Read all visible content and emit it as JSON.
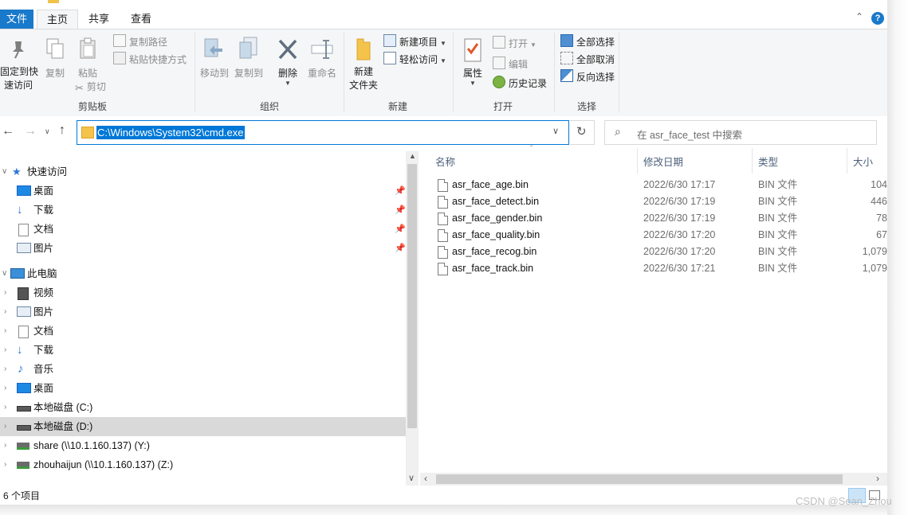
{
  "tabs": {
    "file": "文件",
    "home": "主页",
    "share": "共享",
    "view": "查看"
  },
  "ribbon": {
    "clipboard": {
      "pin_label": "固定到快\n速访问",
      "copy_label": "复制",
      "paste_label": "粘贴",
      "copy_path": "复制路径",
      "paste_shortcut": "粘贴快捷方式",
      "cut": "剪切",
      "group": "剪贴板"
    },
    "organize": {
      "move_to": "移动到",
      "copy_to": "复制到",
      "delete": "删除",
      "rename": "重命名",
      "group": "组织"
    },
    "new": {
      "new_folder": "新建\n文件夹",
      "new_item": "新建项目",
      "easy_access": "轻松访问",
      "group": "新建"
    },
    "open": {
      "properties": "属性",
      "open": "打开",
      "edit": "编辑",
      "history": "历史记录",
      "group": "打开"
    },
    "select": {
      "select_all": "全部选择",
      "select_none": "全部取消",
      "invert": "反向选择",
      "group": "选择"
    }
  },
  "address": {
    "path": "C:\\Windows\\System32\\cmd.exe"
  },
  "search": {
    "placeholder": "在 asr_face_test 中搜索"
  },
  "navpane": {
    "quick_access": "快速访问",
    "quick_items": [
      "桌面",
      "下载",
      "文档",
      "图片"
    ],
    "this_pc": "此电脑",
    "pc_items": [
      "视频",
      "图片",
      "文档",
      "下载",
      "音乐",
      "桌面",
      "本地磁盘 (C:)",
      "本地磁盘 (D:)",
      "share (\\\\10.1.160.137) (Y:)",
      "zhouhaijun (\\\\10.1.160.137) (Z:)"
    ]
  },
  "columns": {
    "name": "名称",
    "date": "修改日期",
    "type": "类型",
    "size": "大小"
  },
  "files": [
    {
      "name": "asr_face_age.bin",
      "date": "2022/6/30 17:17",
      "type": "BIN 文件",
      "size": "104"
    },
    {
      "name": "asr_face_detect.bin",
      "date": "2022/6/30 17:19",
      "type": "BIN 文件",
      "size": "446"
    },
    {
      "name": "asr_face_gender.bin",
      "date": "2022/6/30 17:19",
      "type": "BIN 文件",
      "size": "78"
    },
    {
      "name": "asr_face_quality.bin",
      "date": "2022/6/30 17:20",
      "type": "BIN 文件",
      "size": "67"
    },
    {
      "name": "asr_face_recog.bin",
      "date": "2022/6/30 17:20",
      "type": "BIN 文件",
      "size": "1,079"
    },
    {
      "name": "asr_face_track.bin",
      "date": "2022/6/30 17:21",
      "type": "BIN 文件",
      "size": "1,079"
    }
  ],
  "status": {
    "count": "6 个项目"
  },
  "watermark": "CSDN @Sean_Zhou",
  "colors": {
    "accent": "#0078d7",
    "file_tab": "#1979ca",
    "selected_row": "#d9d9d9"
  }
}
